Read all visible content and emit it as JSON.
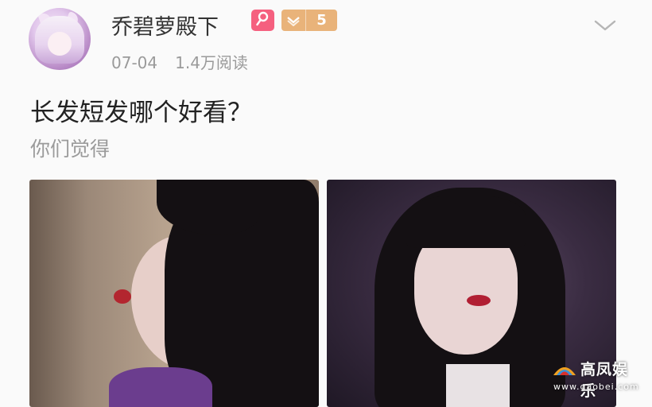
{
  "post": {
    "author": {
      "name": "乔碧萝殿下",
      "gender_icon": "female-icon",
      "level": "5"
    },
    "date": "07-04",
    "reads": "1.4万阅读",
    "title": "长发短发哪个好看？",
    "subtitle": "你们觉得"
  },
  "watermark": {
    "brand": "高凤娱乐",
    "url": "www.gaobei.com"
  },
  "colors": {
    "gender_badge": "#f5607f",
    "level_badge": "#e9b37a",
    "meta_text": "#9a9a9a"
  },
  "icons": [
    "female-icon",
    "chevron-down-icon",
    "level-chevron-icon"
  ]
}
